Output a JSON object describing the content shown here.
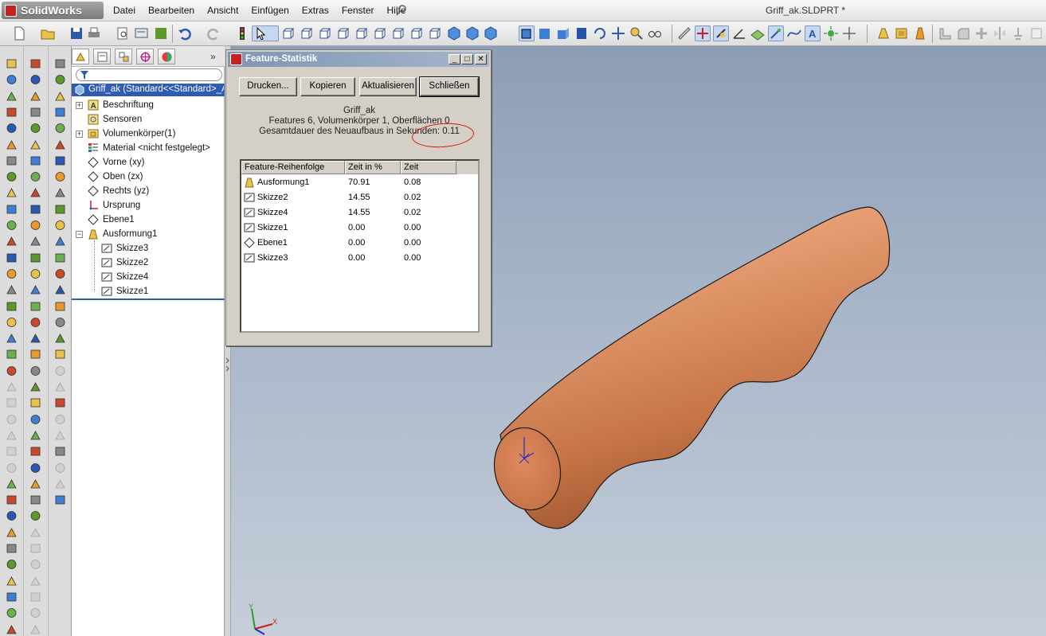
{
  "app": {
    "name": "SolidWorks",
    "document_title": "Griff_ak.SLDPRT *"
  },
  "menu": [
    "Datei",
    "Bearbeiten",
    "Ansicht",
    "Einfügen",
    "Extras",
    "Fenster",
    "Hilfe"
  ],
  "feature_tree": {
    "root": "Griff_ak  (Standard<<Standard>_A",
    "items": [
      {
        "label": "Beschriftung",
        "expander": "+",
        "icon": "annotation-icon"
      },
      {
        "label": "Sensoren",
        "expander": "",
        "icon": "sensor-icon"
      },
      {
        "label": "Volumenkörper(1)",
        "expander": "+",
        "icon": "solid-bodies-icon"
      },
      {
        "label": "Material <nicht festgelegt>",
        "expander": "",
        "icon": "material-icon"
      },
      {
        "label": "Vorne (xy)",
        "expander": "",
        "icon": "plane-icon"
      },
      {
        "label": "Oben (zx)",
        "expander": "",
        "icon": "plane-icon"
      },
      {
        "label": "Rechts (yz)",
        "expander": "",
        "icon": "plane-icon"
      },
      {
        "label": "Ursprung",
        "expander": "",
        "icon": "origin-icon"
      },
      {
        "label": "Ebene1",
        "expander": "",
        "icon": "plane-icon"
      },
      {
        "label": "Ausformung1",
        "expander": "−",
        "icon": "loft-icon"
      }
    ],
    "children": [
      "Skizze3",
      "Skizze2",
      "Skizze4",
      "Skizze1"
    ]
  },
  "dialog": {
    "title": "Feature-Statistik",
    "buttons": {
      "print": "Drucken...",
      "copy": "Kopieren",
      "refresh": "Aktualisieren",
      "close": "Schließen"
    },
    "part_name": "Griff_ak",
    "summary": "Features 6, Volumenkörper 1, Oberflächen 0",
    "rebuild_time": "Gesamtdauer des Neuaufbaus in Sekunden: 0.11",
    "columns": [
      "Feature-Reihenfolge",
      "Zeit in %",
      "Zeit"
    ],
    "rows": [
      {
        "name": "Ausformung1",
        "pct": "70.91",
        "time": "0.08",
        "icon": "loft-icon"
      },
      {
        "name": "Skizze2",
        "pct": "14.55",
        "time": "0.02",
        "icon": "sketch-icon"
      },
      {
        "name": "Skizze4",
        "pct": "14.55",
        "time": "0.02",
        "icon": "sketch-icon"
      },
      {
        "name": "Skizze1",
        "pct": "0.00",
        "time": "0.00",
        "icon": "sketch-icon"
      },
      {
        "name": "Ebene1",
        "pct": "0.00",
        "time": "0.00",
        "icon": "plane-icon"
      },
      {
        "name": "Skizze3",
        "pct": "0.00",
        "time": "0.00",
        "icon": "sketch-icon"
      }
    ]
  },
  "triad": {
    "y": "Y",
    "x": "X"
  },
  "colors": {
    "selection": "#2d5cb2",
    "part": "#d4845c",
    "highlight": "#e01010"
  }
}
